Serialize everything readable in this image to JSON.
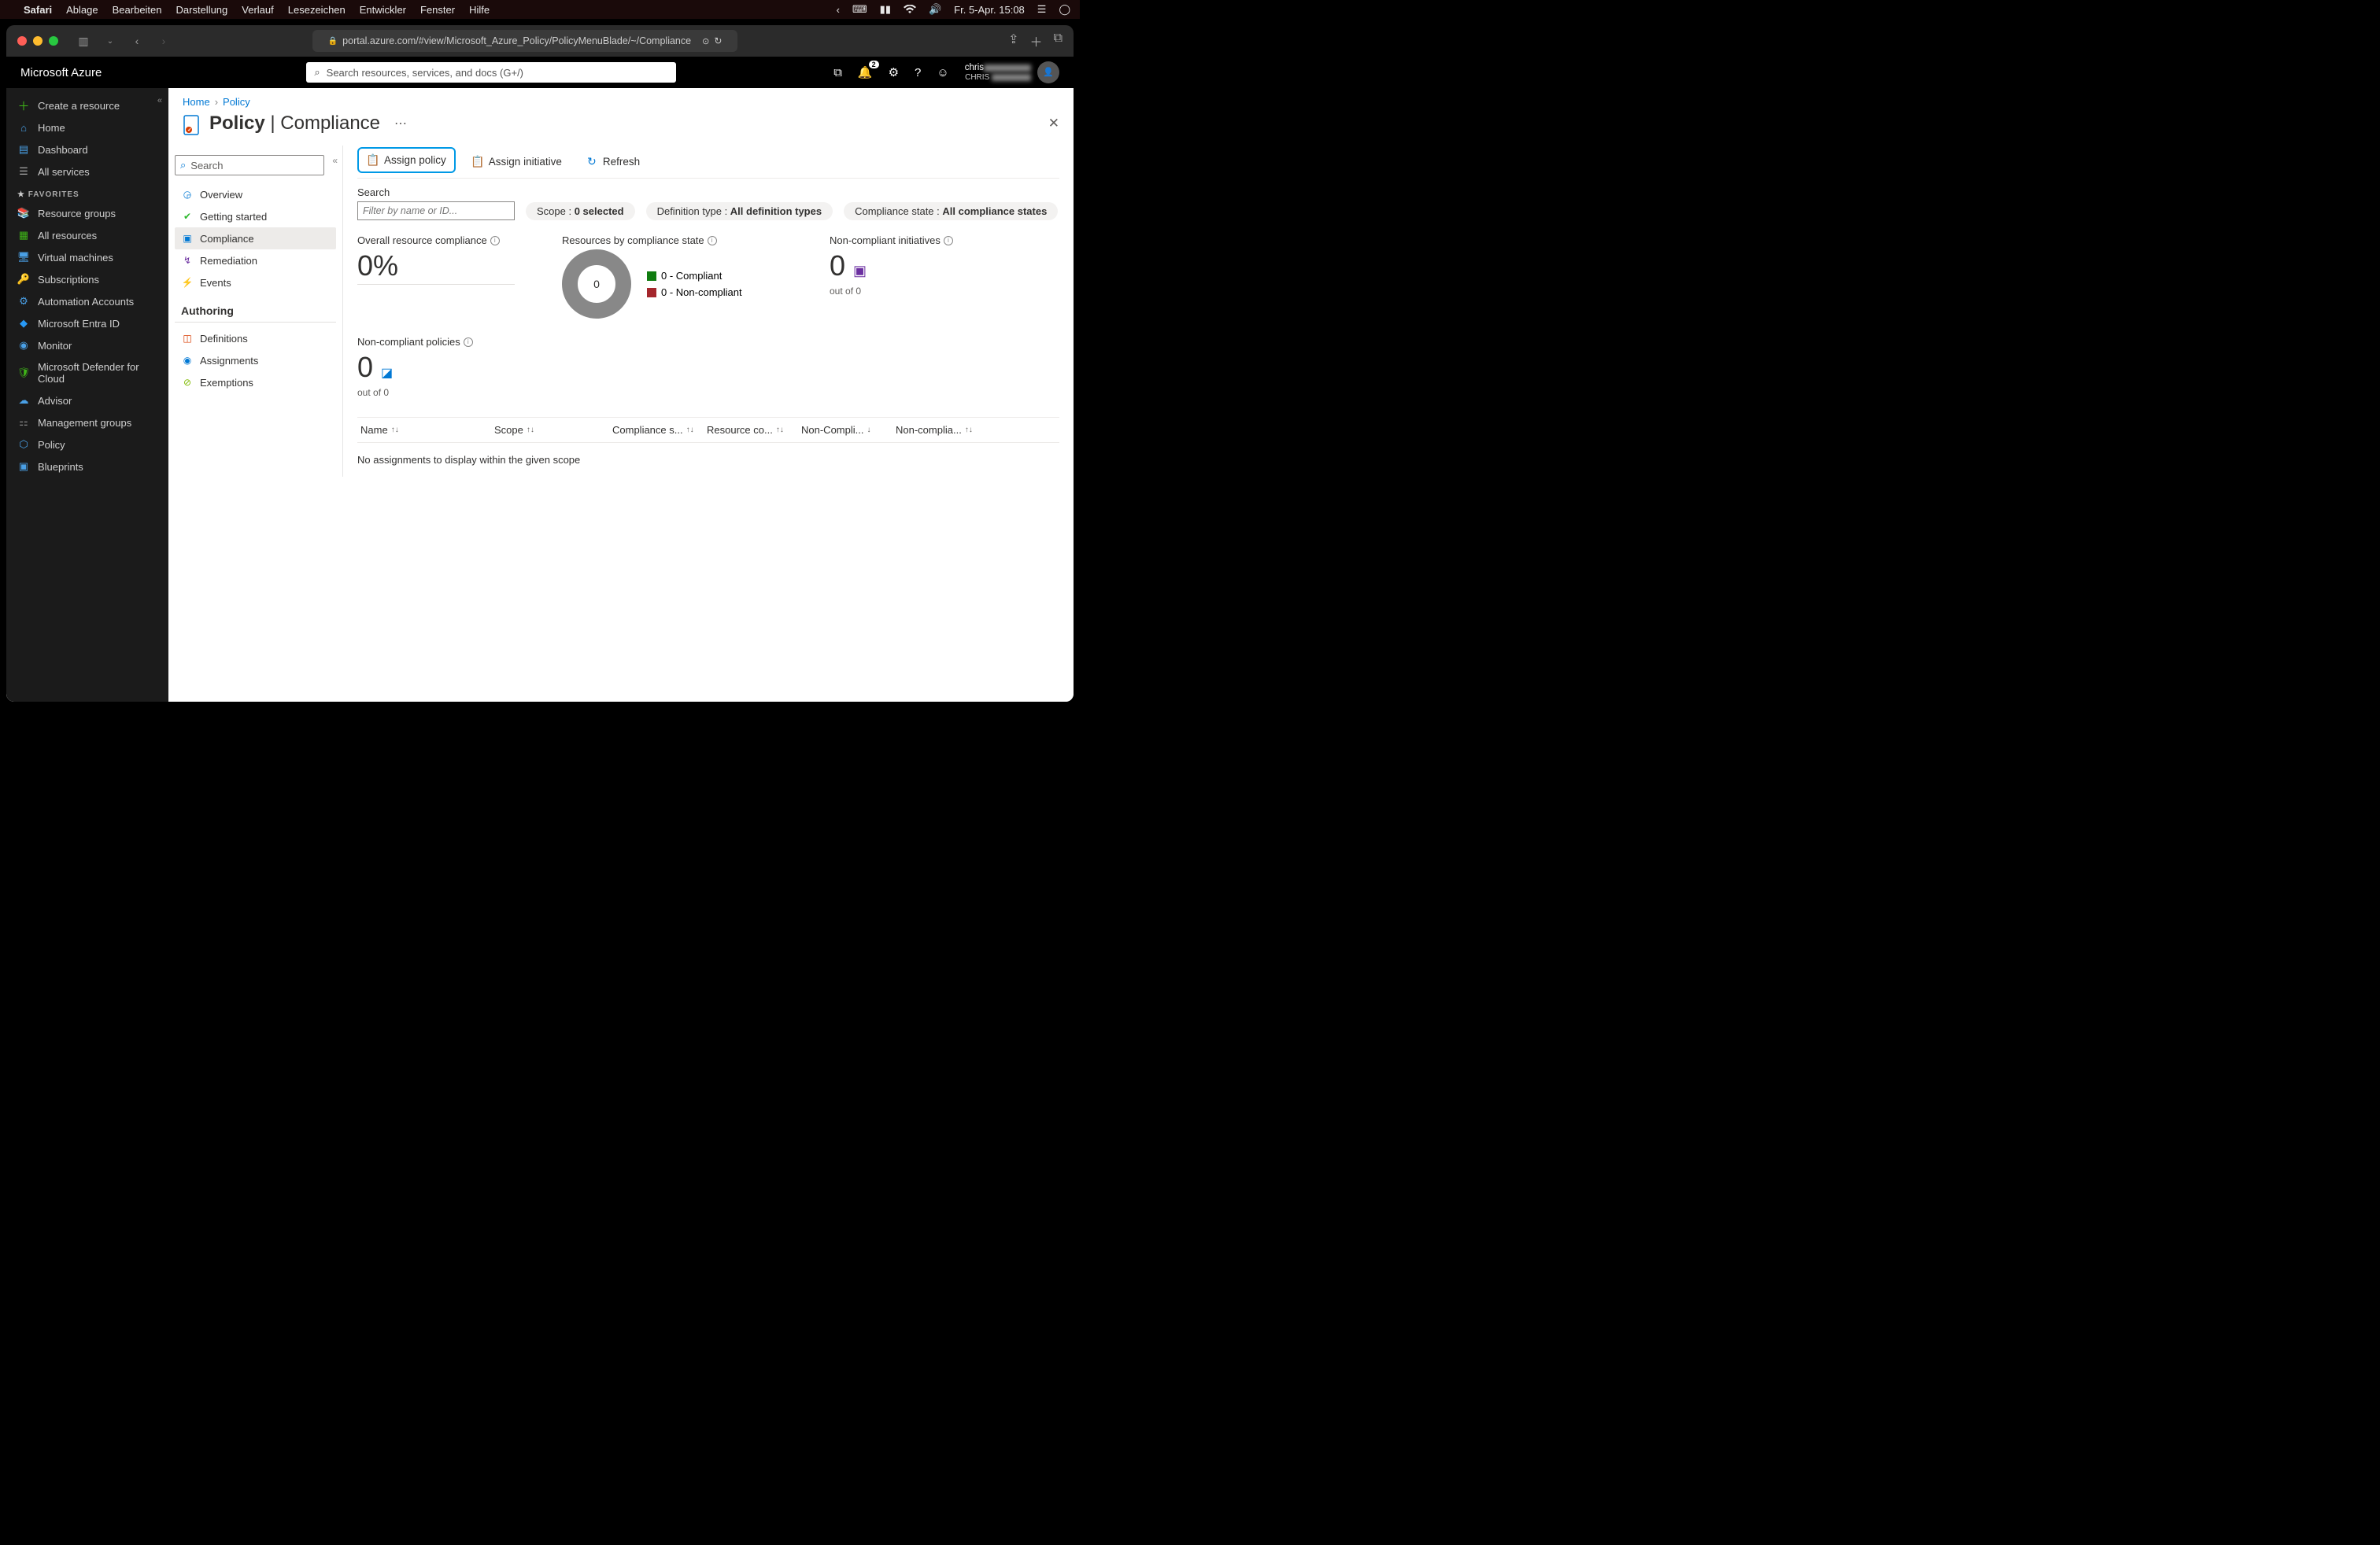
{
  "mac_menu": {
    "app": "Safari",
    "items": [
      "Ablage",
      "Bearbeiten",
      "Darstellung",
      "Verlauf",
      "Lesezeichen",
      "Entwickler",
      "Fenster",
      "Hilfe"
    ],
    "datetime": "Fr. 5-Apr. 15:08"
  },
  "safari": {
    "url": "portal.azure.com/#view/Microsoft_Azure_Policy/PolicyMenuBlade/~/Compliance"
  },
  "azure": {
    "logo": "Microsoft Azure",
    "search_placeholder": "Search resources, services, and docs (G+/)",
    "notif_count": "2",
    "account_line1": "chris",
    "account_line2": "CHRIS"
  },
  "nav_rail": {
    "create": "Create a resource",
    "home": "Home",
    "dashboard": "Dashboard",
    "all_services": "All services",
    "favorites_label": "FAVORITES",
    "items": [
      {
        "icon": "📚",
        "label": "Resource groups",
        "color": "#4aa0e6"
      },
      {
        "icon": "▦",
        "label": "All resources",
        "color": "#3fb618"
      },
      {
        "icon": "🖥",
        "label": "Virtual machines",
        "color": "#4aa0e6"
      },
      {
        "icon": "🔑",
        "label": "Subscriptions",
        "color": "#d9b13b"
      },
      {
        "icon": "⚙",
        "label": "Automation Accounts",
        "color": "#4aa0e6"
      },
      {
        "icon": "◆",
        "label": "Microsoft Entra ID",
        "color": "#2899f5"
      },
      {
        "icon": "◉",
        "label": "Monitor",
        "color": "#4aa0e6"
      },
      {
        "icon": "🛡",
        "label": "Microsoft Defender for Cloud",
        "color": "#3fb618"
      },
      {
        "icon": "☁",
        "label": "Advisor",
        "color": "#4aa0e6"
      },
      {
        "icon": "⚏",
        "label": "Management groups",
        "color": "#888"
      },
      {
        "icon": "⬡",
        "label": "Policy",
        "color": "#4aa0e6"
      },
      {
        "icon": "▣",
        "label": "Blueprints",
        "color": "#4aa0e6"
      }
    ]
  },
  "policy_nav": {
    "search_placeholder": "Search",
    "items_top": [
      {
        "icon": "◶",
        "label": "Overview",
        "color": "#0078d4"
      },
      {
        "icon": "✔",
        "label": "Getting started",
        "color": "#2eb82e"
      },
      {
        "icon": "▣",
        "label": "Compliance",
        "color": "#0078d4",
        "active": true
      },
      {
        "icon": "↯",
        "label": "Remediation",
        "color": "#6b2fa0"
      },
      {
        "icon": "⚡",
        "label": "Events",
        "color": "#f2c811"
      }
    ],
    "section": "Authoring",
    "items_auth": [
      {
        "icon": "◫",
        "label": "Definitions",
        "color": "#d83b01"
      },
      {
        "icon": "◉",
        "label": "Assignments",
        "color": "#0078d4"
      },
      {
        "icon": "⊘",
        "label": "Exemptions",
        "color": "#7fba00"
      }
    ]
  },
  "breadcrumb": {
    "home": "Home",
    "policy": "Policy"
  },
  "page": {
    "title_bold": "Policy",
    "title_light": "Compliance",
    "cmd_assign_policy": "Assign policy",
    "cmd_assign_initiative": "Assign initiative",
    "cmd_refresh": "Refresh",
    "search_label": "Search",
    "filter_placeholder": "Filter by name or ID...",
    "pill_scope_label": "Scope : ",
    "pill_scope_value": "0 selected",
    "pill_def_label": "Definition type : ",
    "pill_def_value": "All definition types",
    "pill_comp_label": "Compliance state : ",
    "pill_comp_value": "All compliance states"
  },
  "stats": {
    "overall_title": "Overall resource compliance",
    "overall_value": "0%",
    "resources_title": "Resources by compliance state",
    "donut_center": "0",
    "legend_compliant": "0 - Compliant",
    "legend_noncompliant": "0 - Non-compliant",
    "noncomp_init_title": "Non-compliant initiatives",
    "noncomp_init_value": "0",
    "noncomp_init_sub": "out of 0",
    "noncomp_pol_title": "Non-compliant policies",
    "noncomp_pol_value": "0",
    "noncomp_pol_sub": "out of 0"
  },
  "table": {
    "cols": [
      "Name",
      "Scope",
      "Compliance s...",
      "Resource co...",
      "Non-Compli...",
      "Non-complia..."
    ],
    "empty": "No assignments to display within the given scope"
  },
  "chart_data": {
    "type": "pie",
    "title": "Resources by compliance state",
    "series": [
      {
        "name": "Compliant",
        "value": 0,
        "color": "#107c10"
      },
      {
        "name": "Non-compliant",
        "value": 0,
        "color": "#a4262c"
      }
    ],
    "total_label": "0"
  }
}
